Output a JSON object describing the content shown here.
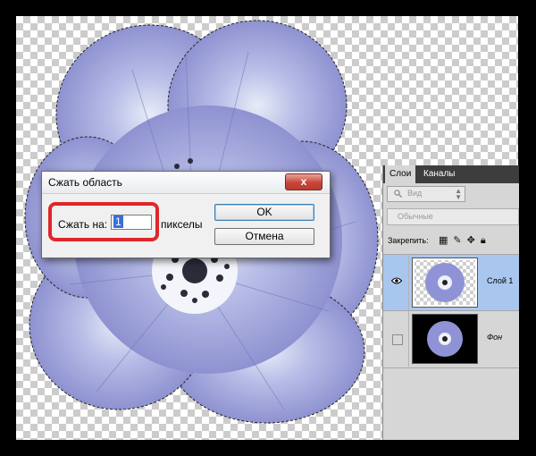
{
  "dialog": {
    "title": "Сжать область",
    "close_symbol": "x",
    "contract_label": "Сжать на:",
    "contract_value": "1",
    "units_label": "пикселы",
    "ok_label": "OK",
    "cancel_label": "Отмена"
  },
  "layers_panel": {
    "tabs": [
      "Слои",
      "Каналы"
    ],
    "filter_placeholder": "Вид",
    "blend_mode": "Обычные",
    "lock_label": "Закрепить:",
    "layers": [
      {
        "name": "Слой 1",
        "visible": true,
        "selected": true,
        "thumbnail": "flower-on-transparency"
      },
      {
        "name": "Фон",
        "visible": false,
        "selected": false,
        "thumbnail": "flower-on-black"
      }
    ]
  },
  "icons": {
    "eye": "eye-icon",
    "search": "search-icon",
    "lock_transparent": "checker-lock-icon",
    "lock_paint": "brush-icon",
    "lock_move": "move-icon",
    "lock_all": "lock-icon"
  },
  "colors": {
    "flower_petal": "#8b8fd0",
    "highlight_ring": "#e0262a",
    "selected_layer": "#a9c7ee",
    "close_button": "#c6463a"
  }
}
